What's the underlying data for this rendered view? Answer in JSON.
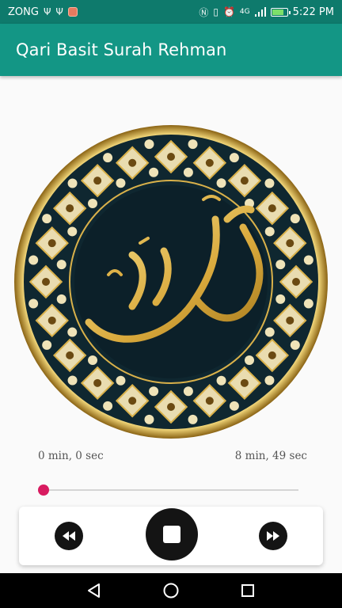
{
  "status_bar": {
    "carrier": "ZONG",
    "network": "4G",
    "time": "5:22 PM",
    "battery_level": 0.85
  },
  "app_bar": {
    "title": "Qari Basit Surah Rehman"
  },
  "player": {
    "current_time": "0 min, 0 sec",
    "total_time": "8 min, 49 sec",
    "progress": 0.0
  },
  "controls": {
    "rewind_icon": "rewind-icon",
    "stop_icon": "stop-icon",
    "forward_icon": "fast-forward-icon"
  },
  "colors": {
    "status_bar": "#0e7a6c",
    "app_bar": "#139685",
    "accent": "#d81b60",
    "artwork_dark": "#0f2730",
    "artwork_gold": "#d9b14a"
  }
}
